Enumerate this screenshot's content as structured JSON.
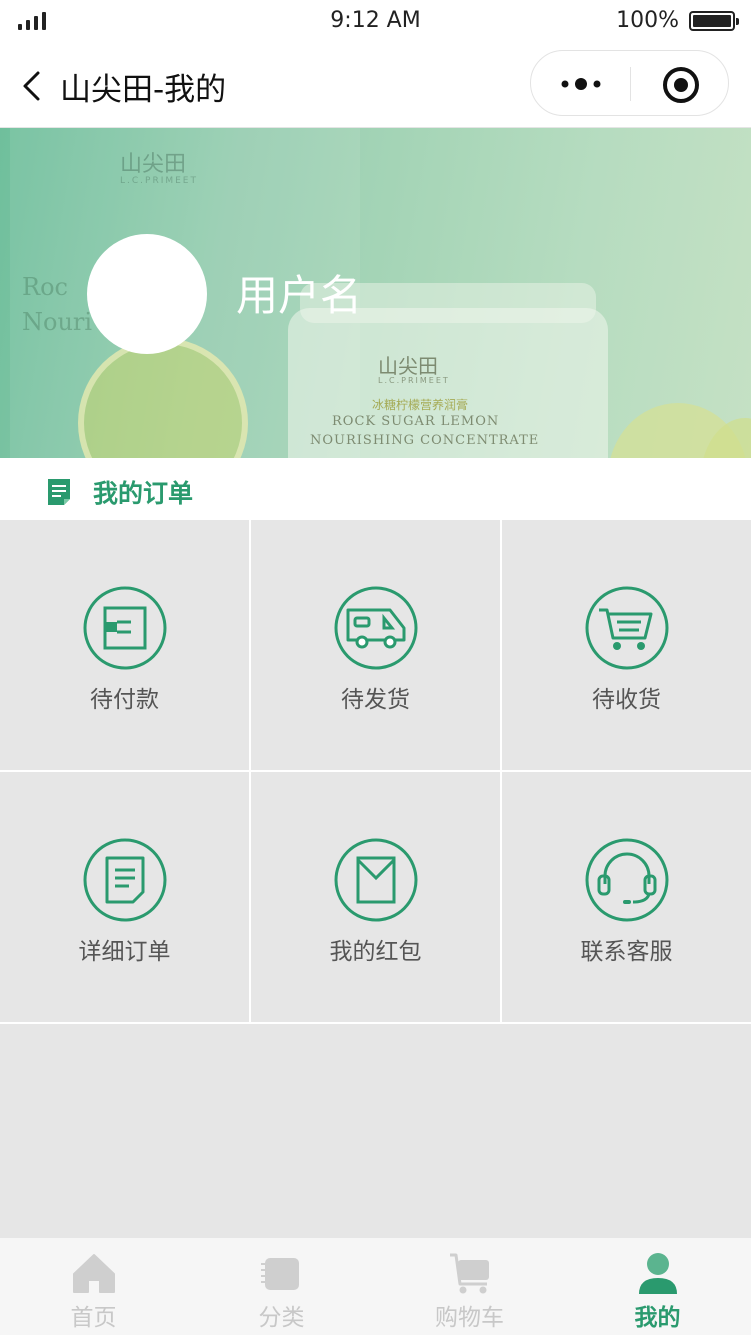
{
  "status_bar": {
    "time": "9:12 AM",
    "battery": "100%"
  },
  "nav": {
    "title": "山尖田-我的"
  },
  "banner": {
    "username": "用户名",
    "bg_brand": "山尖田",
    "bg_brand_sub": "L.C.PRIMEET",
    "bg_text_1": "Roc",
    "bg_text_2": "Nouri",
    "jar_brand": "山尖田",
    "jar_brand_sub": "L.C.PRIMEET",
    "jar_cn": "冰糖柠檬营养润膏",
    "jar_en_1": "ROCK SUGAR LEMON",
    "jar_en_2": "NOURISHING CONCENTRATE"
  },
  "orders": {
    "title": "我的订单",
    "items": [
      {
        "label": "待付款",
        "icon": "wallet-icon"
      },
      {
        "label": "待发货",
        "icon": "truck-icon"
      },
      {
        "label": "待收货",
        "icon": "cart-icon"
      },
      {
        "label": "详细订单",
        "icon": "document-icon"
      },
      {
        "label": "我的红包",
        "icon": "envelope-icon"
      },
      {
        "label": "联系客服",
        "icon": "headset-icon"
      }
    ]
  },
  "tabbar": {
    "items": [
      {
        "label": "首页",
        "icon": "home-icon",
        "active": false
      },
      {
        "label": "分类",
        "icon": "category-icon",
        "active": false
      },
      {
        "label": "购物车",
        "icon": "cart-icon",
        "active": false
      },
      {
        "label": "我的",
        "icon": "user-icon",
        "active": true
      }
    ]
  },
  "colors": {
    "accent": "#2a9a6e",
    "tab_inactive": "#c8c8c8",
    "grid_bg": "#e6e6e6"
  }
}
